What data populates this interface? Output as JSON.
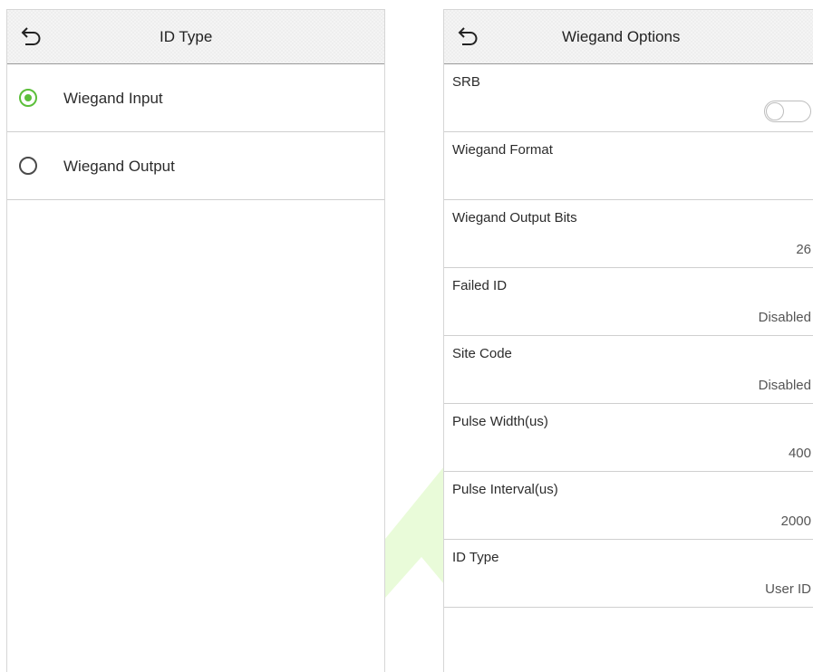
{
  "left_screen": {
    "title": "ID Type",
    "options": [
      {
        "label": "Wiegand Input",
        "selected": true
      },
      {
        "label": "Wiegand Output",
        "selected": false
      }
    ]
  },
  "right_screen": {
    "title": "Wiegand Options",
    "items": [
      {
        "label": "SRB",
        "value": "",
        "control": "toggle",
        "on": false
      },
      {
        "label": "Wiegand Format",
        "value": ""
      },
      {
        "label": "Wiegand Output Bits",
        "value": "26"
      },
      {
        "label": "Failed ID",
        "value": "Disabled"
      },
      {
        "label": "Site Code",
        "value": "Disabled"
      },
      {
        "label": "Pulse Width(us)",
        "value": "400"
      },
      {
        "label": "Pulse Interval(us)",
        "value": "2000"
      },
      {
        "label": "ID Type",
        "value": "User ID"
      }
    ]
  },
  "icons": {
    "back": "back-arrow-icon",
    "watermark": "watermark-arrow-icon"
  },
  "colors": {
    "accent_green": "#5cbf3b",
    "watermark_green": "#e9fbd9"
  }
}
